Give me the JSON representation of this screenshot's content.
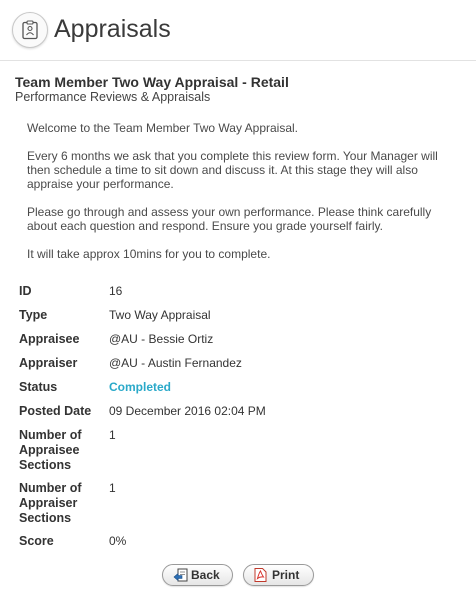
{
  "header": {
    "title": "Appraisals",
    "icon": "clipboard-person-icon"
  },
  "form": {
    "title": "Team Member Two Way Appraisal - Retail",
    "subtitle": "Performance Reviews & Appraisals"
  },
  "intro": [
    "Welcome to the Team Member Two Way Appraisal.",
    "Every 6 months we ask that you complete this review form. Your Manager will then schedule a time to sit down and discuss it. At this stage they will also appraise your performance.",
    "Please go through and assess your own performance. Please think carefully about each question and respond. Ensure you grade yourself fairly.",
    "It will take approx 10mins for you to complete."
  ],
  "details": {
    "id": {
      "label": "ID",
      "value": "16"
    },
    "type": {
      "label": "Type",
      "value": "Two Way Appraisal"
    },
    "appraisee": {
      "label": "Appraisee",
      "value": "@AU - Bessie Ortiz"
    },
    "appraiser": {
      "label": "Appraiser",
      "value": "@AU - Austin Fernandez"
    },
    "status": {
      "label": "Status",
      "value": "Completed"
    },
    "posted_date": {
      "label": "Posted Date",
      "value": "09 December 2016 02:04 PM"
    },
    "appraisee_sections": {
      "label": "Number of Appraisee Sections",
      "value": "1"
    },
    "appraiser_sections": {
      "label": "Number of Appraiser Sections",
      "value": "1"
    },
    "score": {
      "label": "Score",
      "value": "0%"
    }
  },
  "buttons": {
    "back": {
      "label": "Back",
      "icon": "back-page-icon"
    },
    "print": {
      "label": "Print",
      "icon": "pdf-icon"
    }
  },
  "colors": {
    "status_completed": "#2aa9c9",
    "text": "#333333"
  }
}
